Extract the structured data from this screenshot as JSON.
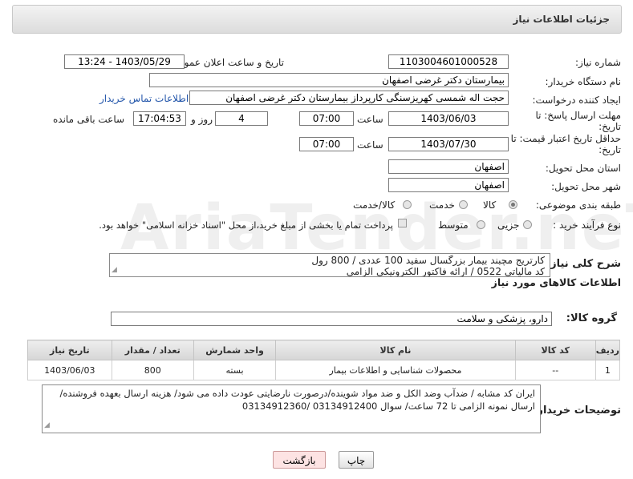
{
  "header": {
    "title": "جزئیات اطلاعات نیاز"
  },
  "form": {
    "need_number": {
      "label": "شماره نیاز:",
      "value": "1103004601000528"
    },
    "announce_datetime": {
      "label": "تاریخ و ساعت اعلان عمومی:",
      "value": "1403/05/29 - 13:24"
    },
    "buyer_org": {
      "label": "نام دستگاه خریدار:",
      "value": "بیمارستان دکتر غرضی اصفهان"
    },
    "creator": {
      "label": "ایجاد کننده درخواست:",
      "value": "حجت اله شمسی کهریزسنگی کارپرداز بیمارستان دکتر غرضی اصفهان",
      "contact_link": "اطلاعات تماس خریدار"
    },
    "response_deadline": {
      "label_line1": "مهلت ارسال پاسخ: تا",
      "label_line2": "تاریخ:",
      "date": "1403/06/03",
      "time_label": "ساعت",
      "time": "07:00",
      "days": "4",
      "days_label": "روز و",
      "remaining": "17:04:53",
      "remaining_label": "ساعت باقی مانده"
    },
    "price_validity": {
      "label_line1": "حداقل تاریخ اعتبار قیمت: تا",
      "label_line2": "تاریخ:",
      "date": "1403/07/30",
      "time_label": "ساعت",
      "time": "07:00"
    },
    "province": {
      "label": "استان محل تحویل:",
      "value": "اصفهان"
    },
    "city": {
      "label": "شهر محل تحویل:",
      "value": "اصفهان"
    },
    "category": {
      "label": "طبقه بندی موضوعی:",
      "options": [
        "کالا",
        "خدمت",
        "کالا/خدمت"
      ],
      "selected": "کالا"
    },
    "purchase_type": {
      "label": "نوع فرآیند خرید :",
      "options": [
        "جزیی",
        "متوسط"
      ],
      "payment_note": "پرداخت تمام یا بخشی از مبلغ خرید،از محل \"اسناد خزانه اسلامی\" خواهد بود."
    }
  },
  "general_description": {
    "label": "شرح کلی نیاز:",
    "line1": "کارتریج مچبند بیمار بزرگسال سفید 100 عددی / 800 رول",
    "line2": "کد مالیاتی 0522  / ارائه فاکتور الکترونیکی الزامی"
  },
  "goods_info": {
    "title": "اطلاعات کالاهای مورد نیاز",
    "group_label": "گروه کالا:",
    "group_value": "دارو، پزشکی و سلامت"
  },
  "table": {
    "headers": [
      "ردیف",
      "کد کالا",
      "نام کالا",
      "واحد شمارش",
      "تعداد / مقدار",
      "تاریخ نیاز"
    ],
    "rows": [
      [
        "1",
        "--",
        "محصولات شناسایی و اطلاعات بیمار",
        "بسته",
        "800",
        "1403/06/03"
      ]
    ]
  },
  "buyer_notes": {
    "label": "توضیحات خریدار:",
    "line1": "ایران کد مشابه / ضدآب وضد الکل و ضد مواد شوینده/درصورت نارضایتی عودت داده می شود/ هزینه ارسال بعهده فروشنده/",
    "line2": "ارسال نمونه الزامی تا 72 ساعت/ سوال 03134912400 /03134912360"
  },
  "buttons": {
    "print": "چاپ",
    "back": "بازگشت"
  },
  "watermark": "AriaTender.neT",
  "colors": {
    "link": "#2255aa",
    "back_button_bg": "#fde3e3",
    "header_bg": "#e4e4e4"
  }
}
